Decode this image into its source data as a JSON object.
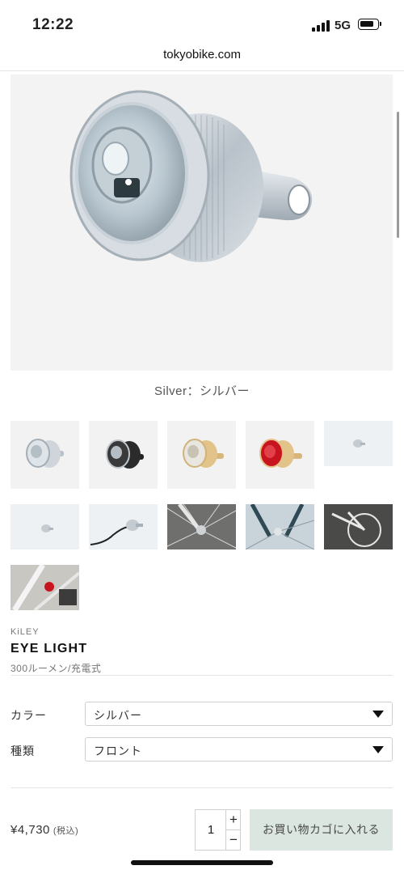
{
  "status": {
    "time": "12:22",
    "network": "5G"
  },
  "browser": {
    "url": "tokyobike.com"
  },
  "gallery": {
    "caption": "Silver：シルバー",
    "thumbnails": [
      {
        "label": "silver light"
      },
      {
        "label": "black light"
      },
      {
        "label": "gold light"
      },
      {
        "label": "red light"
      },
      {
        "label": "small light"
      },
      {
        "label": "small light 2"
      },
      {
        "label": "light with cable"
      },
      {
        "label": "wheel hub"
      },
      {
        "label": "front fork"
      },
      {
        "label": "bicycle"
      },
      {
        "label": "red rear light on frame"
      }
    ]
  },
  "product": {
    "brand": "KiLEY",
    "name": "EYE LIGHT",
    "spec": "300ルーメン/充電式"
  },
  "options": {
    "color_label": "カラー",
    "color_value": "シルバー",
    "type_label": "種類",
    "type_value": "フロント"
  },
  "purchase": {
    "price": "¥4,730",
    "tax_note": "(税込)",
    "quantity": "1",
    "plus": "+",
    "minus": "−",
    "cart_button": "お買い物カゴに入れる"
  }
}
